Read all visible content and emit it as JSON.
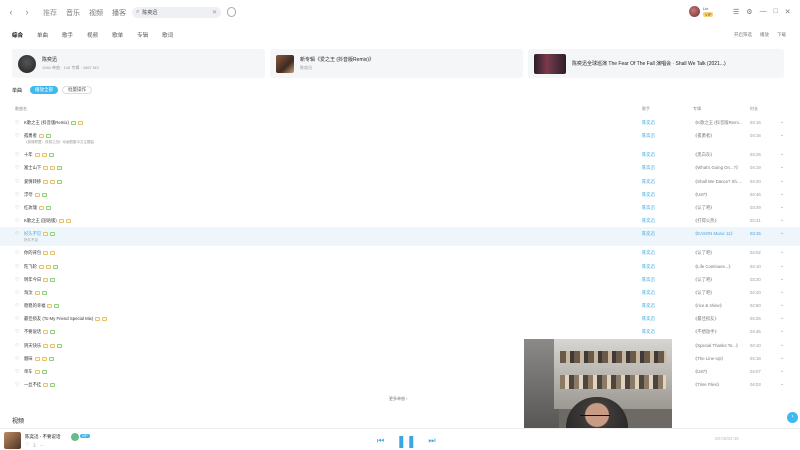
{
  "nav": {
    "back": "‹",
    "forward": "›"
  },
  "top_links": [
    "推荐",
    "音乐",
    "视频",
    "播客"
  ],
  "search": {
    "value": "陈奕迅",
    "placeholder": "搜索音乐"
  },
  "user": {
    "name": "Lin",
    "vip": "VIP"
  },
  "window_icons": [
    "☰",
    "⚙",
    "—",
    "□",
    "✕"
  ],
  "tabs": [
    "综合",
    "单曲",
    "歌手",
    "视频",
    "歌单",
    "专辑",
    "歌词"
  ],
  "tabs_right": [
    "开启筛选",
    "播放",
    "下载"
  ],
  "cards": [
    {
      "title": "陈奕迅",
      "sub": "1984 单曲 · 145 专辑 · 1887 MV"
    },
    {
      "title": "新专辑《爱之王 (抖音版Remix)》",
      "sub": "陈奕迅"
    },
    {
      "title": "陈奕迅全球巡演 The Fear Of The Fall 演唱会 · Shall We Talk (2021...)",
      "sub": ""
    }
  ],
  "song_section": {
    "label": "单曲",
    "play_all": "播放全部",
    "multi_select": "批量操作"
  },
  "columns": {
    "title": "歌曲名",
    "artist": "歌手",
    "album": "专辑",
    "duration": "时长"
  },
  "songs": [
    {
      "title": "K歌之王 (抖音版Remix)",
      "artist": "陈奕迅",
      "album": "《K歌之王 (抖音版Remi...》",
      "duration": "03:16"
    },
    {
      "title": "孤勇者",
      "sub": "《英雄联盟：双城之战》动画剧集中文主题曲",
      "artist": "陈奕迅",
      "album": "《孤勇者》",
      "duration": "04:16"
    },
    {
      "title": "十年",
      "artist": "陈奕迅",
      "album": "《黑白灰》",
      "duration": "03:25"
    },
    {
      "title": "富士山下",
      "artist": "陈奕迅",
      "album": "《What's Going On...?》",
      "duration": "04:19"
    },
    {
      "title": "爱情转移",
      "artist": "陈奕迅",
      "album": "《Shall We Dance? Sh...》",
      "duration": "04:20"
    },
    {
      "title": "浮夸",
      "artist": "陈奕迅",
      "album": "《U87》",
      "duration": "04:46"
    },
    {
      "title": "红玫瑰",
      "artist": "陈奕迅",
      "album": "《认了吧》",
      "duration": "03:49"
    },
    {
      "title": "K歌之王 (国语版)",
      "artist": "陈奕迅",
      "album": "《打得火热》",
      "duration": "03:41"
    },
    {
      "title": "好久不见",
      "sub": "好久不见",
      "artist": "陈奕迅",
      "album": "《EASON Music 11》",
      "duration": "03:15"
    },
    {
      "title": "你的背包",
      "artist": "陈奕迅",
      "album": "《认了吧》",
      "duration": "04:02"
    },
    {
      "title": "陀飞轮",
      "artist": "陈奕迅",
      "album": "《Life Continues...》",
      "duration": "04:10"
    },
    {
      "title": "明年今日",
      "artist": "陈奕迅",
      "album": "《认了吧》",
      "duration": "03:20"
    },
    {
      "title": "淘汰",
      "artist": "陈奕迅",
      "album": "《认了吧》",
      "duration": "04:40"
    },
    {
      "title": "稳稳的幸福",
      "artist": "陈奕迅",
      "album": "《rice & shine》",
      "duration": "04:50"
    },
    {
      "title": "最佳损友 (To My Friend Special Mix)",
      "artist": "陈奕迅",
      "album": "《最佳损友》",
      "duration": "04:26"
    },
    {
      "title": "不要说话",
      "artist": "陈奕迅",
      "album": "《不想放手》",
      "duration": "04:45"
    },
    {
      "title": "阴天快乐",
      "artist": "陈奕迅",
      "album": "《Special Thanks To...》",
      "duration": "04:10"
    },
    {
      "title": "烟味",
      "artist": "陈奕迅",
      "album": "《The Line-Up》",
      "duration": "04:18"
    },
    {
      "title": "单车",
      "artist": "陈奕迅",
      "album": "《U87》",
      "duration": "04:07"
    },
    {
      "title": "一丝不挂",
      "artist": "陈奕迅",
      "album": "《Time Flies》",
      "duration": "04:03"
    }
  ],
  "load_more": "更多单曲 ›",
  "videos_label": "视频",
  "player": {
    "song": "陈奕迅 - 不要说话",
    "badge": "VIP",
    "prev": "⏮",
    "pause": "❚❚",
    "next": "⏭",
    "right_text": "00:00/04:45",
    "small_ctrls": [
      "♡",
      "⤓",
      "…"
    ]
  },
  "accent_color": "#3fb8f0",
  "link_color": "#3da5e0"
}
